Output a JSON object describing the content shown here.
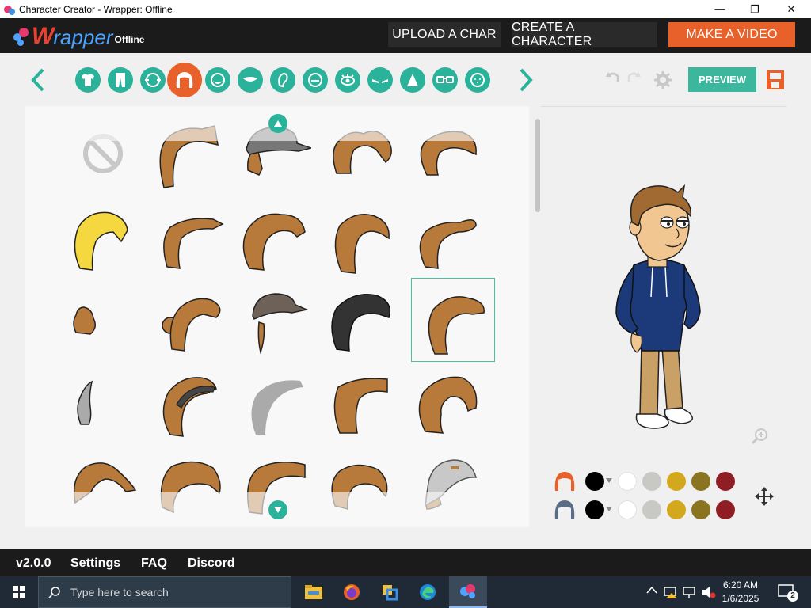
{
  "window": {
    "title": "Character Creator - Wrapper: Offline",
    "minimize_glyph": "—",
    "restore_glyph": "❐",
    "close_glyph": "✕"
  },
  "header": {
    "logo_w": "W",
    "logo_rest": "rapper",
    "logo_sub": "Offline",
    "buttons": [
      {
        "label": "UPLOAD A CHAR"
      },
      {
        "label": "CREATE A CHARACTER"
      },
      {
        "label": "MAKE A VIDEO"
      }
    ],
    "primary_color": "#e8602a"
  },
  "toolbar": {
    "categories": [
      {
        "name": "shirt-icon"
      },
      {
        "name": "pants-icon"
      },
      {
        "name": "face-shape-icon"
      },
      {
        "name": "hair-icon",
        "active": true
      },
      {
        "name": "beard-icon"
      },
      {
        "name": "mouth-icon"
      },
      {
        "name": "ear-icon"
      },
      {
        "name": "nose-icon"
      },
      {
        "name": "eye-icon"
      },
      {
        "name": "eyebrow-icon"
      },
      {
        "name": "hat-icon"
      },
      {
        "name": "glasses-icon"
      },
      {
        "name": "face-detail-icon"
      }
    ],
    "preview_label": "PREVIEW",
    "accent_color": "#2ab39a",
    "active_color": "#e8602a"
  },
  "hair_grid": {
    "rows": 5,
    "columns": 5,
    "selected_index": 14,
    "items": [
      "none",
      "hair-1",
      "hat-cap-hair",
      "hair-pigtails",
      "hair-ponytail",
      "hair-blonde-spiky",
      "hair-slick",
      "hair-curly",
      "hair-long-wavy",
      "hair-swoop",
      "hair-bun-small",
      "hair-bun",
      "hat-cap-2",
      "hair-black-afro",
      "hair-messy",
      "hair-gray-tuft",
      "hair-curly-headband",
      "hair-gray-swoop",
      "hair-flat",
      "hair-bob",
      "hair-side-swoop",
      "hair-short",
      "hair-flat-top",
      "hair-short-2",
      "hat-cap-gray"
    ]
  },
  "color_rows": [
    {
      "part": "hair-color",
      "colors": [
        "#000000",
        "#ffffff",
        "#c8c8c4",
        "#d4a81c",
        "#8a7420",
        "#8e1d24"
      ]
    },
    {
      "part": "hat-color",
      "colors": [
        "#000000",
        "#ffffff",
        "#c8c8c4",
        "#d4a81c",
        "#8a7420",
        "#8e1d24"
      ]
    }
  ],
  "footer": {
    "version": "v2.0.0",
    "links": [
      "Settings",
      "FAQ",
      "Discord"
    ]
  },
  "taskbar": {
    "search_placeholder": "Type here to search",
    "time": "6:20 AM",
    "date": "1/6/2025",
    "notifications": "2"
  }
}
